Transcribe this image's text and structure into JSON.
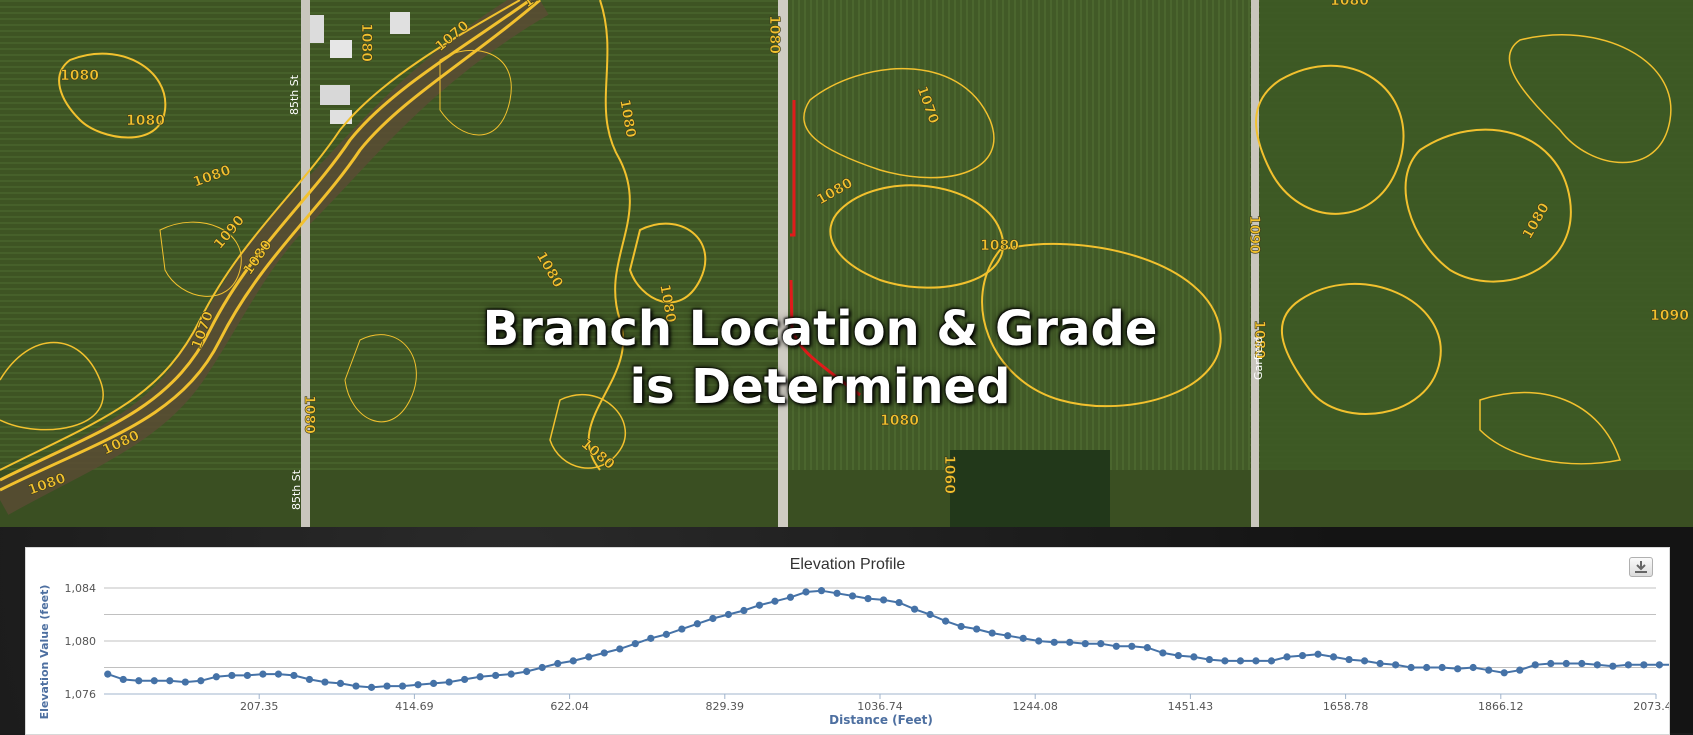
{
  "map": {
    "overlay_title_line1": "Branch Location & Grade",
    "overlay_title_line2": "is Determined",
    "contour_labels": [
      "1080",
      "1070",
      "1060",
      "1080",
      "1080",
      "1090",
      "1070",
      "1080",
      "1080",
      "1080",
      "1080",
      "1080",
      "1080",
      "1080",
      "1080",
      "1080",
      "1080",
      "1070",
      "1060",
      "1080",
      "1090",
      "1080",
      "1080",
      "1080",
      "1080",
      "1090",
      "1080"
    ],
    "road_labels": [
      "85th St",
      "85th St",
      "Garfield"
    ],
    "colors": {
      "contour": "#f2c12e",
      "field": "#3f5524",
      "road": "#cfcfcf",
      "drain_line": "#e01b1b"
    }
  },
  "chart": {
    "title": "Elevation Profile",
    "download_icon": "download-icon",
    "ylabel": "Elevation Value (feet)",
    "xlabel": "Distance (Feet)",
    "y_tick_labels": [
      "1,084",
      "1,080",
      "1,076"
    ],
    "x_tick_labels": [
      "207.35",
      "414.69",
      "622.04",
      "829.39",
      "1036.74",
      "1244.08",
      "1451.43",
      "1658.78",
      "1866.12",
      "2073.47"
    ],
    "colors": {
      "series": "#4572a7",
      "grid": "#c0c0c0",
      "axis_label": "#4d6fa0"
    }
  },
  "chart_data": {
    "type": "line",
    "title": "Elevation Profile",
    "xlabel": "Distance (Feet)",
    "ylabel": "Elevation Value (feet)",
    "xlim": [
      0,
      2073.47
    ],
    "ylim": [
      1076,
      1084
    ],
    "grid": true,
    "x_step": 20.73,
    "values": [
      1077.5,
      1077.1,
      1077.0,
      1077.0,
      1077.0,
      1076.9,
      1077.0,
      1077.3,
      1077.4,
      1077.4,
      1077.5,
      1077.5,
      1077.4,
      1077.1,
      1076.9,
      1076.8,
      1076.6,
      1076.5,
      1076.6,
      1076.6,
      1076.7,
      1076.8,
      1076.9,
      1077.1,
      1077.3,
      1077.4,
      1077.5,
      1077.7,
      1078.0,
      1078.3,
      1078.5,
      1078.8,
      1079.1,
      1079.4,
      1079.8,
      1080.2,
      1080.5,
      1080.9,
      1081.3,
      1081.7,
      1082.0,
      1082.3,
      1082.7,
      1083.0,
      1083.3,
      1083.7,
      1083.8,
      1083.6,
      1083.4,
      1083.2,
      1083.1,
      1082.9,
      1082.4,
      1082.0,
      1081.5,
      1081.1,
      1080.9,
      1080.6,
      1080.4,
      1080.2,
      1080.0,
      1079.9,
      1079.9,
      1079.8,
      1079.8,
      1079.6,
      1079.6,
      1079.5,
      1079.1,
      1078.9,
      1078.8,
      1078.6,
      1078.5,
      1078.5,
      1078.5,
      1078.5,
      1078.8,
      1078.9,
      1079.0,
      1078.8,
      1078.6,
      1078.5,
      1078.3,
      1078.2,
      1078.0,
      1078.0,
      1078.0,
      1077.9,
      1078.0,
      1077.8,
      1077.6,
      1077.8,
      1078.2,
      1078.3,
      1078.3,
      1078.3,
      1078.2,
      1078.1,
      1078.2,
      1078.2,
      1078.2,
      1078.2,
      1078.0,
      1078.0,
      1078.0,
      1078.0,
      1078.0,
      1078.0,
      1078.0,
      1077.9,
      1077.7,
      1077.7,
      1077.8
    ]
  }
}
